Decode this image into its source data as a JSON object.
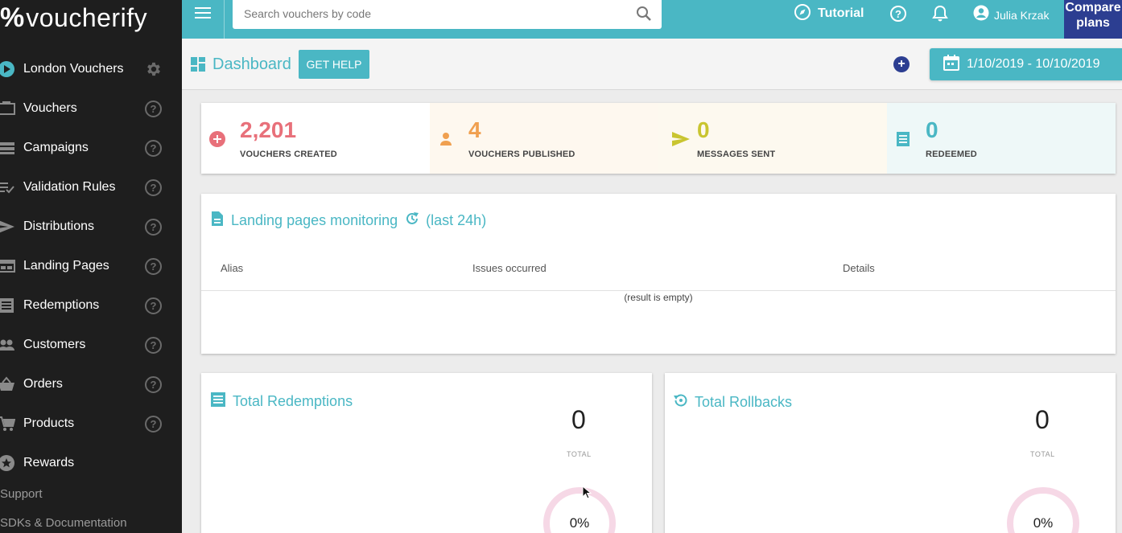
{
  "brand": {
    "logo_mark": "%",
    "logo_text": "voucherify"
  },
  "sidebar": {
    "project": {
      "label": "London Vouchers",
      "icon": "play-circle-icon",
      "settings_icon": "gear-icon"
    },
    "items": [
      {
        "label": "Vouchers",
        "icon": "ticket-icon"
      },
      {
        "label": "Campaigns",
        "icon": "campaigns-icon"
      },
      {
        "label": "Validation Rules",
        "icon": "checklist-icon"
      },
      {
        "label": "Distributions",
        "icon": "send-icon"
      },
      {
        "label": "Landing Pages",
        "icon": "browser-icon"
      },
      {
        "label": "Redemptions",
        "icon": "list-icon"
      },
      {
        "label": "Customers",
        "icon": "people-icon"
      },
      {
        "label": "Orders",
        "icon": "basket-icon"
      },
      {
        "label": "Products",
        "icon": "cart-icon"
      },
      {
        "label": "Rewards",
        "icon": "star-icon"
      }
    ],
    "help_glyph": "?",
    "support": "Support",
    "docs": "SDKs & Documentation"
  },
  "topbar": {
    "search_placeholder": "Search vouchers by code",
    "tutorial": "Tutorial",
    "help_glyph": "?",
    "user_name": "Julia Krzak",
    "compare_line1": "Compare",
    "compare_line2": "plans"
  },
  "subheader": {
    "title": "Dashboard",
    "get_help": "GET HELP",
    "add_glyph": "+",
    "date_range": "1/10/2019 - 10/10/2019"
  },
  "stats": [
    {
      "value": "2,201",
      "label": "VOUCHERS CREATED",
      "color": "#e8707a",
      "bg": "#ffffff",
      "icon": "add-circle-icon"
    },
    {
      "value": "4",
      "label": "VOUCHERS PUBLISHED",
      "color": "#f0a050",
      "bg": "#fef8ef",
      "icon": "person-icon"
    },
    {
      "value": "0",
      "label": "MESSAGES SENT",
      "color": "#c9c530",
      "bg": "#fdf9ef",
      "icon": "send-icon"
    },
    {
      "value": "0",
      "label": "REDEEMED",
      "color": "#4ab7c4",
      "bg": "#eef8f8",
      "icon": "receipt-icon"
    }
  ],
  "landing": {
    "title": "Landing pages monitoring",
    "period": "(last 24h)",
    "columns": [
      "Alias",
      "Issues occurred",
      "Details"
    ],
    "empty_text": "(result is empty)"
  },
  "totals": [
    {
      "title": "Total Redemptions",
      "value": "0",
      "caption": "TOTAL",
      "percent": "0%",
      "icon": "receipt-icon"
    },
    {
      "title": "Total Rollbacks",
      "value": "0",
      "caption": "TOTAL",
      "percent": "0%",
      "icon": "history-icon"
    }
  ],
  "colors": {
    "accent": "#4ab7c4",
    "brand_dark": "#2c3e91",
    "sidebar_bg": "#1e1e1e"
  }
}
